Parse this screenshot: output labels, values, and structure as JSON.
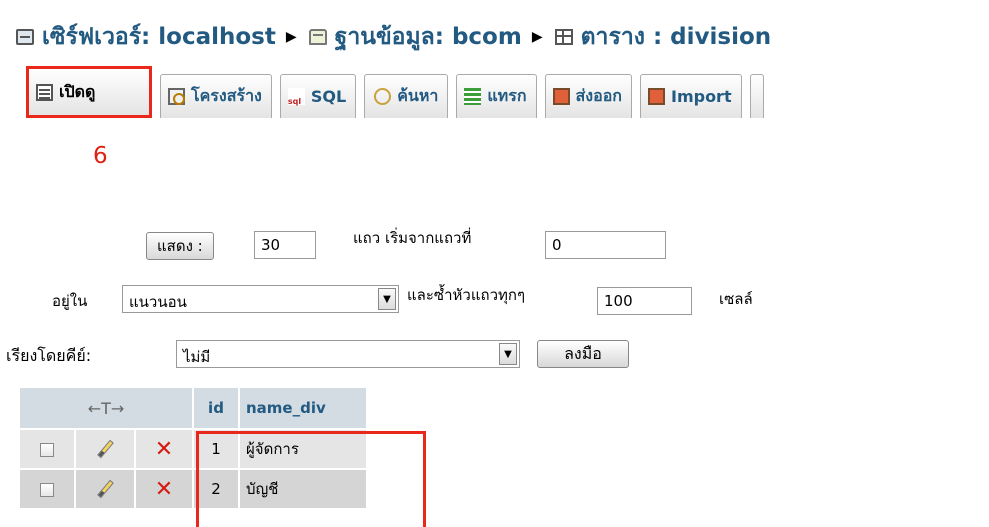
{
  "breadcrumb": {
    "server": "เซิร์ฟเวอร์: localhost",
    "database": "ฐานข้อมูล: bcom",
    "table": "ตาราง : division",
    "separator": "▶"
  },
  "tabs": [
    {
      "label": "เปิดดู",
      "icon": "browse-icon"
    },
    {
      "label": "โครงสร้าง",
      "icon": "structure-icon"
    },
    {
      "label": "SQL",
      "icon": "sql-icon"
    },
    {
      "label": "ค้นหา",
      "icon": "search-icon"
    },
    {
      "label": "แทรก",
      "icon": "insert-icon"
    },
    {
      "label": "ส่งออก",
      "icon": "export-icon"
    },
    {
      "label": "Import",
      "icon": "import-icon"
    }
  ],
  "annotation_number": "6",
  "form": {
    "show_button": "แสดง :",
    "rows_value": "30",
    "rows_from_label": "แถว เริ่มจากแถวที่",
    "start_value": "0",
    "mode_label": "อยู่ใน",
    "mode_value": "แนวนอน",
    "repeat_label": "และซ้ำหัวแถวทุกๆ",
    "repeat_value": "100",
    "cells_label": "เซลล์",
    "sort_label": "เรียงโดยคีย์:",
    "sort_value": "ไม่มี",
    "go_button": "ลงมือ"
  },
  "grid": {
    "headers": {
      "arrows": "←T→",
      "id": "id",
      "name": "name_div"
    },
    "rows": [
      {
        "id": "1",
        "name_div": "ผู้จัดการ"
      },
      {
        "id": "2",
        "name_div": "บัญชี"
      }
    ]
  },
  "colors": {
    "link": "#235a81",
    "annotation": "#e8281b",
    "header_bg": "#d3dce3"
  }
}
